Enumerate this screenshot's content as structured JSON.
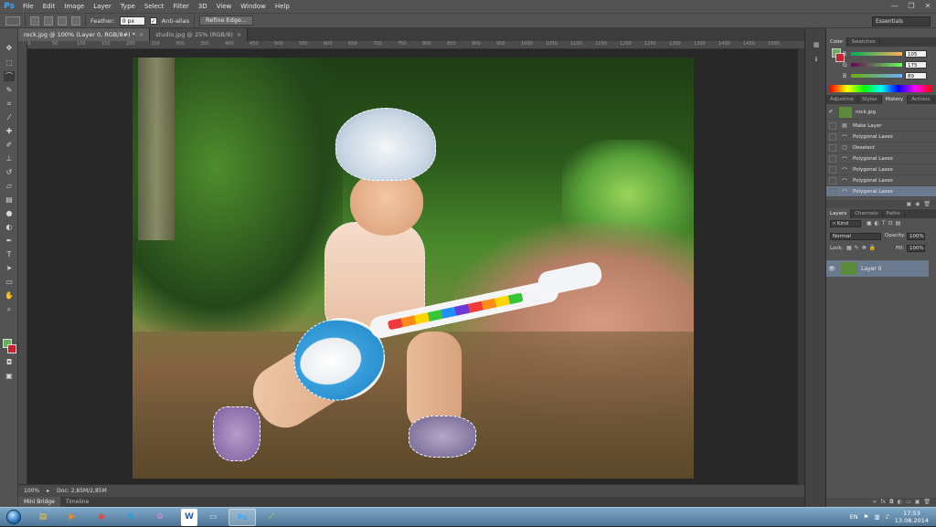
{
  "app": {
    "logo": "Ps"
  },
  "menu": [
    "File",
    "Edit",
    "Image",
    "Layer",
    "Type",
    "Select",
    "Filter",
    "3D",
    "View",
    "Window",
    "Help"
  ],
  "window_controls": [
    "—",
    "❐",
    "✕"
  ],
  "options_bar": {
    "feather_label": "Feather:",
    "feather_value": "0 px",
    "antialias_label": "Anti-alias",
    "antialias_checked": true,
    "refine_edge_label": "Refine Edge..."
  },
  "workspace": "Essentials",
  "doc_tabs": [
    {
      "label": "rock.jpg @ 100% (Layer 0, RGB/8#) *",
      "active": true
    },
    {
      "label": "studio.jpg @ 25% (RGB/8)",
      "active": false
    }
  ],
  "ruler_ticks": [
    "0",
    "50",
    "100",
    "150",
    "200",
    "250",
    "300",
    "350",
    "400",
    "450",
    "500",
    "550",
    "600",
    "650",
    "700",
    "750",
    "800",
    "850",
    "900",
    "950",
    "1000",
    "1050",
    "1100",
    "1150",
    "1200",
    "1250",
    "1300",
    "1350",
    "1400",
    "1450",
    "1500"
  ],
  "status": {
    "zoom": "100%",
    "doc": "Doc: 2,85M/2,85M"
  },
  "bottom_tabs": [
    "Mini Bridge",
    "Timeline"
  ],
  "color_panel": {
    "tabs": [
      "Color",
      "Swatches"
    ],
    "fg_color": "#69af59",
    "bg_color": "#c8202c",
    "sliders": [
      {
        "label": "R",
        "value": "105"
      },
      {
        "label": "G",
        "value": "175"
      },
      {
        "label": "B",
        "value": "89"
      }
    ]
  },
  "history_panel": {
    "tabs": [
      "Adjustme",
      "Styles",
      "History",
      "Actions"
    ],
    "snapshot": "rock.jpg",
    "items": [
      "Make Layer",
      "Polygonal Lasso",
      "Deselect",
      "Polygonal Lasso",
      "Polygonal Lasso",
      "Polygonal Lasso",
      "Polygonal Lasso"
    ]
  },
  "layers_panel": {
    "tabs": [
      "Layers",
      "Channels",
      "Paths"
    ],
    "kind": "Kind",
    "blend_mode": "Normal",
    "opacity_label": "Opacity:",
    "opacity": "100%",
    "lock_label": "Lock:",
    "fill_label": "Fill:",
    "fill": "100%",
    "layer_name": "Layer 0"
  },
  "tray": {
    "lang": "EN",
    "time": "17:53",
    "date": "13.08.2014"
  }
}
